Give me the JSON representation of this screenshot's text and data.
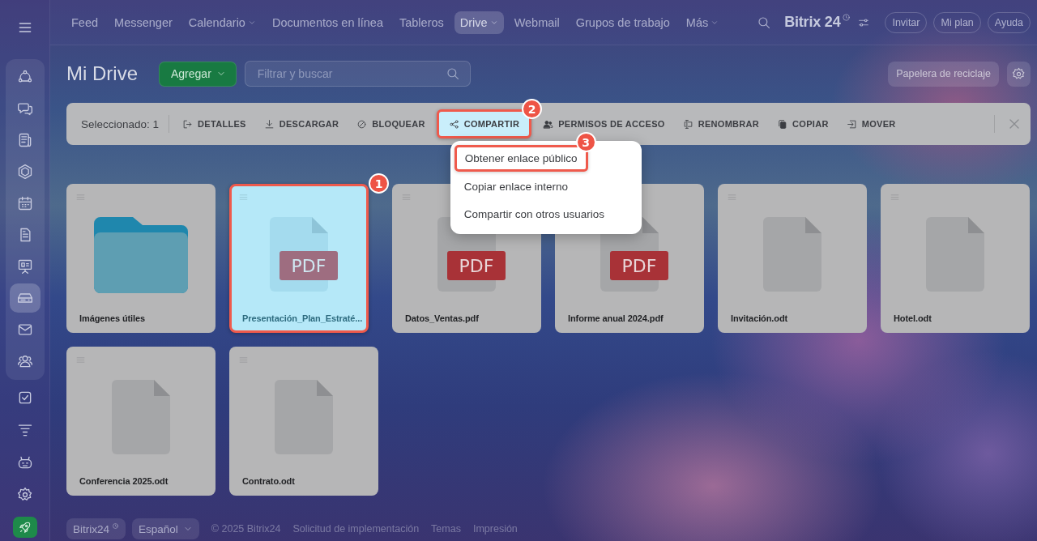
{
  "sidebar": {
    "menu": {
      "kind": "menu"
    },
    "pinned": [
      {
        "kind": "nodes",
        "selected": false
      },
      {
        "kind": "chat",
        "selected": false
      },
      {
        "kind": "news",
        "selected": false
      },
      {
        "kind": "hexagon",
        "selected": false
      },
      {
        "kind": "calendar",
        "selected": false
      },
      {
        "kind": "document",
        "selected": false
      },
      {
        "kind": "presentation",
        "selected": false
      },
      {
        "kind": "drive",
        "selected": true
      },
      {
        "kind": "mail",
        "selected": false
      },
      {
        "kind": "people",
        "selected": false
      }
    ],
    "more": [
      {
        "kind": "check",
        "selected": false
      },
      {
        "kind": "funnel",
        "selected": false
      },
      {
        "kind": "robot",
        "selected": false
      },
      {
        "kind": "settings",
        "selected": false
      }
    ],
    "launch": {
      "kind": "rocket"
    }
  },
  "top_nav": {
    "items": [
      {
        "label": "Feed",
        "dropdown": false,
        "selected": false
      },
      {
        "label": "Messenger",
        "dropdown": false,
        "selected": false
      },
      {
        "label": "Calendario",
        "dropdown": true,
        "selected": false
      },
      {
        "label": "Documentos en línea",
        "dropdown": false,
        "selected": false
      },
      {
        "label": "Tableros",
        "dropdown": false,
        "selected": false
      },
      {
        "label": "Drive",
        "dropdown": true,
        "selected": true
      },
      {
        "label": "Webmail",
        "dropdown": false,
        "selected": false
      },
      {
        "label": "Grupos de trabajo",
        "dropdown": false,
        "selected": false
      },
      {
        "label": "Más",
        "dropdown": true,
        "selected": false
      }
    ],
    "logo": "Bitrix 24",
    "buttons": [
      "Invitar",
      "Mi plan",
      "Ayuda"
    ]
  },
  "header": {
    "title": "Mi Drive",
    "add_button": "Agregar",
    "search": {
      "placeholder": "Filtrar y buscar"
    },
    "trash_button": "Papelera de reciclaje"
  },
  "toolbar": {
    "selection": "Seleccionado: 1",
    "actions": [
      {
        "kind": "details",
        "label": "DETALLES",
        "highlighted": false
      },
      {
        "kind": "download",
        "label": "DESCARGAR",
        "highlighted": false
      },
      {
        "kind": "lock",
        "label": "BLOQUEAR",
        "highlighted": false
      },
      {
        "kind": "share",
        "label": "COMPARTIR",
        "highlighted": true,
        "badge": "2"
      },
      {
        "kind": "permissions",
        "label": "PERMISOS DE ACCESO",
        "highlighted": false
      },
      {
        "kind": "rename",
        "label": "RENOMBRAR",
        "highlighted": false
      },
      {
        "kind": "copy",
        "label": "COPIAR",
        "highlighted": false
      },
      {
        "kind": "move",
        "label": "MOVER",
        "highlighted": false
      }
    ]
  },
  "share_menu": {
    "items": [
      {
        "label": "Obtener enlace público",
        "highlighted": true,
        "badge": "3"
      },
      {
        "label": "Copiar enlace interno",
        "highlighted": false
      },
      {
        "label": "Compartir con otros usuarios",
        "highlighted": false
      }
    ]
  },
  "files": [
    {
      "kind": "folder",
      "name": "Imágenes útiles",
      "selected": false
    },
    {
      "kind": "pdf",
      "name": "Presentación_Plan_Estraté...",
      "label": "PDF",
      "selected": true,
      "badge": "1"
    },
    {
      "kind": "pdf",
      "name": "Datos_Ventas.pdf",
      "label": "PDF",
      "selected": false
    },
    {
      "kind": "pdf",
      "name": "Informe anual 2024.pdf",
      "label": "PDF",
      "selected": false
    },
    {
      "kind": "file",
      "name": "Invitación.odt",
      "selected": false
    },
    {
      "kind": "file",
      "name": "Hotel.odt",
      "selected": false
    },
    {
      "kind": "file",
      "name": "Conferencia 2025.odt",
      "selected": false
    },
    {
      "kind": "file",
      "name": "Contrato.odt",
      "selected": false
    }
  ],
  "footer": {
    "brand_button": "Bitrix24",
    "language_button": "Español",
    "copyright": "© 2025 Bitrix24",
    "links": [
      "Solicitud de implementación",
      "Temas",
      "Impresión"
    ]
  }
}
